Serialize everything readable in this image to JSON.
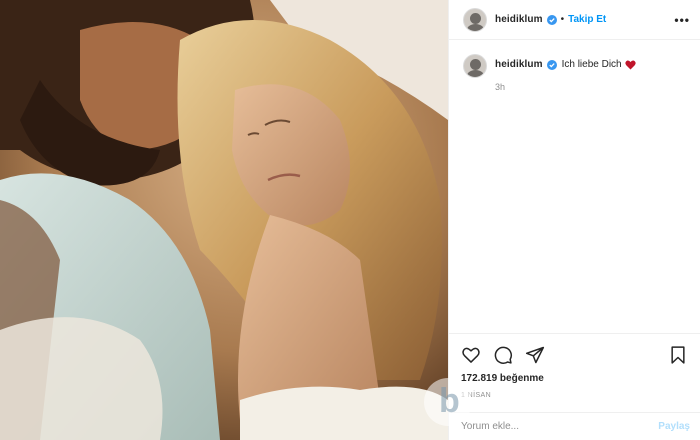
{
  "post": {
    "username": "heidiklum",
    "follow_label": "Takip Et",
    "dot": "•",
    "more_label": "•••",
    "caption_text": "Ich liebe Dich",
    "caption_time": "3h",
    "likes_label": "172.819 beğenme",
    "date_label": "1 NİSAN"
  },
  "comment": {
    "placeholder": "Yorum ekle...",
    "share_label": "Paylaş"
  },
  "colors": {
    "link": "#0095f6",
    "verified": "#3897f0",
    "heart": "#c0142a"
  }
}
